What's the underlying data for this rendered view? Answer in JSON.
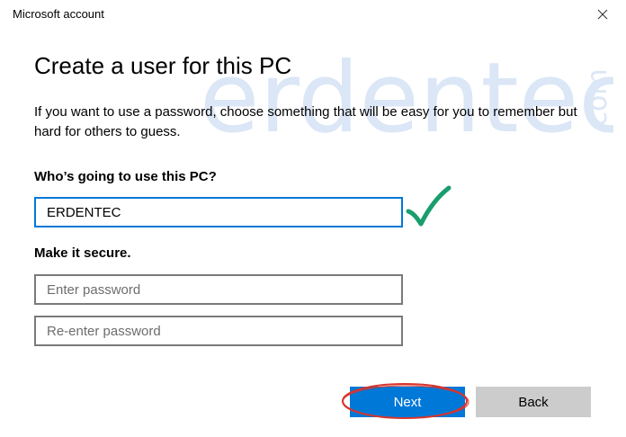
{
  "window": {
    "title": "Microsoft account",
    "close_icon": "close-icon"
  },
  "watermark": {
    "main": "erdentec",
    "suffix": ".com",
    "color": "#dbe6f6"
  },
  "content": {
    "heading": "Create a user for this PC",
    "description": "If you want to use a password, choose something that will be easy for you to remember but hard for others to guess.",
    "username_label": "Who’s going to use this PC?",
    "username_value": "ERDENTEC",
    "secure_label": "Make it secure.",
    "password_placeholder": "Enter password",
    "reenter_placeholder": "Re-enter password"
  },
  "annotations": {
    "checkmark_color": "#1a9e6e",
    "highlight_color": "#d9342b",
    "checkmark_icon": "checkmark-icon"
  },
  "buttons": {
    "next_label": "Next",
    "back_label": "Back",
    "accent": "#0078d7",
    "secondary": "#cccccc"
  }
}
